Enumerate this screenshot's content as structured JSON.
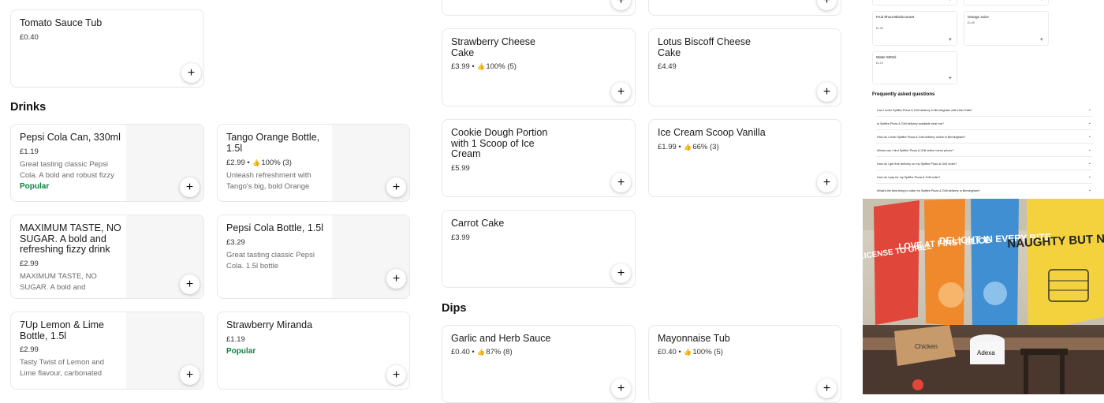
{
  "left_column": {
    "top_item": {
      "name": "Tomato Sauce Tub",
      "price": "£0.40"
    },
    "drinks_title": "Drinks",
    "drinks": [
      {
        "name": "Pepsi Cola Can, 330ml",
        "price": "£1.19",
        "description": "Great tasting classic Pepsi Cola. A bold and robust fizzy",
        "popular": "Popular"
      },
      {
        "name": "Tango Orange Bottle, 1.5l",
        "price": "£2.99",
        "rating": "100% (3)",
        "description": "Unleash refreshment with Tango's big, bold Orange"
      },
      {
        "name": "MAXIMUM TASTE, NO SUGAR. A bold and refreshing fizzy drink",
        "price": "£2.99",
        "description": "MAXIMUM TASTE, NO SUGAR. A bold and"
      },
      {
        "name": "Pepsi Cola Bottle, 1.5l",
        "price": "£3.29",
        "description": "Great tasting classic Pepsi Cola. 1.5l bottle"
      },
      {
        "name": "7Up Lemon & Lime Bottle, 1.5l",
        "price": "£2.99",
        "description": "Tasty Twist of Lemon and Lime flavour, carbonated"
      },
      {
        "name": "Strawberry Miranda",
        "price": "£1.19",
        "popular": "Popular"
      }
    ]
  },
  "middle_column": {
    "desserts": [
      {
        "name": "Strawberry Cheese Cake",
        "price": "£3.99",
        "rating": "100% (5)"
      },
      {
        "name": "Lotus Biscoff Cheese Cake",
        "price": "£4.49"
      },
      {
        "name": "Cookie Dough Portion with 1 Scoop of Ice Cream",
        "price": "£5.99"
      },
      {
        "name": "Ice Cream Scoop Vanilla",
        "price": "£1.99",
        "rating": "66% (3)"
      },
      {
        "name": "Carrot Cake",
        "price": "£3.99"
      }
    ],
    "dips_title": "Dips",
    "dips": [
      {
        "name": "Garlic and Herb Sauce",
        "price": "£0.40",
        "rating": "87% (8)"
      },
      {
        "name": "Mayonnaise Tub",
        "price": "£0.40",
        "rating": "100% (5)"
      }
    ]
  },
  "right_panel": {
    "mini_items": [
      {
        "name": "Fruit Shoot Blackcurrant",
        "price": "£1.29"
      },
      {
        "name": "Orange Juice",
        "price": "£1.49"
      },
      {
        "name": "Water 500ml",
        "price": "£1.19"
      }
    ],
    "faq_title": "Frequently asked questions",
    "faqs": [
      "Can I order Spitfire Pizza & Grill delivery in Birmingham with Uber Eats?",
      "Is Spitfire Pizza & Grill delivery available near me?",
      "How do I order Spitfire Pizza & Grill delivery online in Birmingham?",
      "Where can I find Spitfire Pizza & Grill online menu prices?",
      "How do I get free delivery on my Spitfire Pizza & Grill order?",
      "How do I pay for my Spitfire Pizza & Grill order?",
      "What's the best thing to order for Spitfire Pizza & Grill delivery in Birmingham?"
    ],
    "photo_banners": [
      "LICENSE TO GRILL",
      "LOVE AT FIRST SLICE",
      "DELIGHT IN EVERY BITE",
      "NAUGHTY BUT NICE"
    ],
    "photo_labels": {
      "bucket": "Chicken",
      "box": "Adexa"
    }
  },
  "add_symbol": "+",
  "thumb_symbol": "👍",
  "chevron": "⌄",
  "dot": "•"
}
